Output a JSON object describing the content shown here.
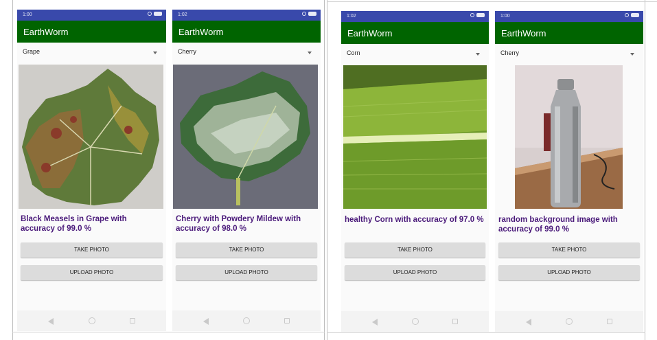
{
  "app_title": "EarthWorm",
  "buttons": {
    "take_photo": "TAKE PHOTO",
    "upload_photo": "UPLOAD PHOTO"
  },
  "colors": {
    "status_bar": "#3949ab",
    "app_bar": "#006400",
    "result_text": "#4a1a7a",
    "button_bg": "#dcdcdc"
  },
  "icons": [
    "signal-icon",
    "wifi-icon",
    "battery-icon",
    "dropdown-arrow-icon",
    "nav-back-icon",
    "nav-home-icon",
    "nav-recent-icon"
  ],
  "screens": [
    {
      "time": "1:00",
      "spinner": "Grape",
      "result": "Black Measels in Grape with accuracy of 99.0 %"
    },
    {
      "time": "1:02",
      "spinner": "Cherry",
      "result": "Cherry with Powdery Mildew with accuracy of 98.0 %"
    },
    {
      "time": "1:02",
      "spinner": "Corn",
      "result": "healthy Corn with accuracy of 97.0 %"
    },
    {
      "time": "1:00",
      "spinner": "Cherry",
      "result": "random background image with accuracy of 99.0 %"
    }
  ]
}
